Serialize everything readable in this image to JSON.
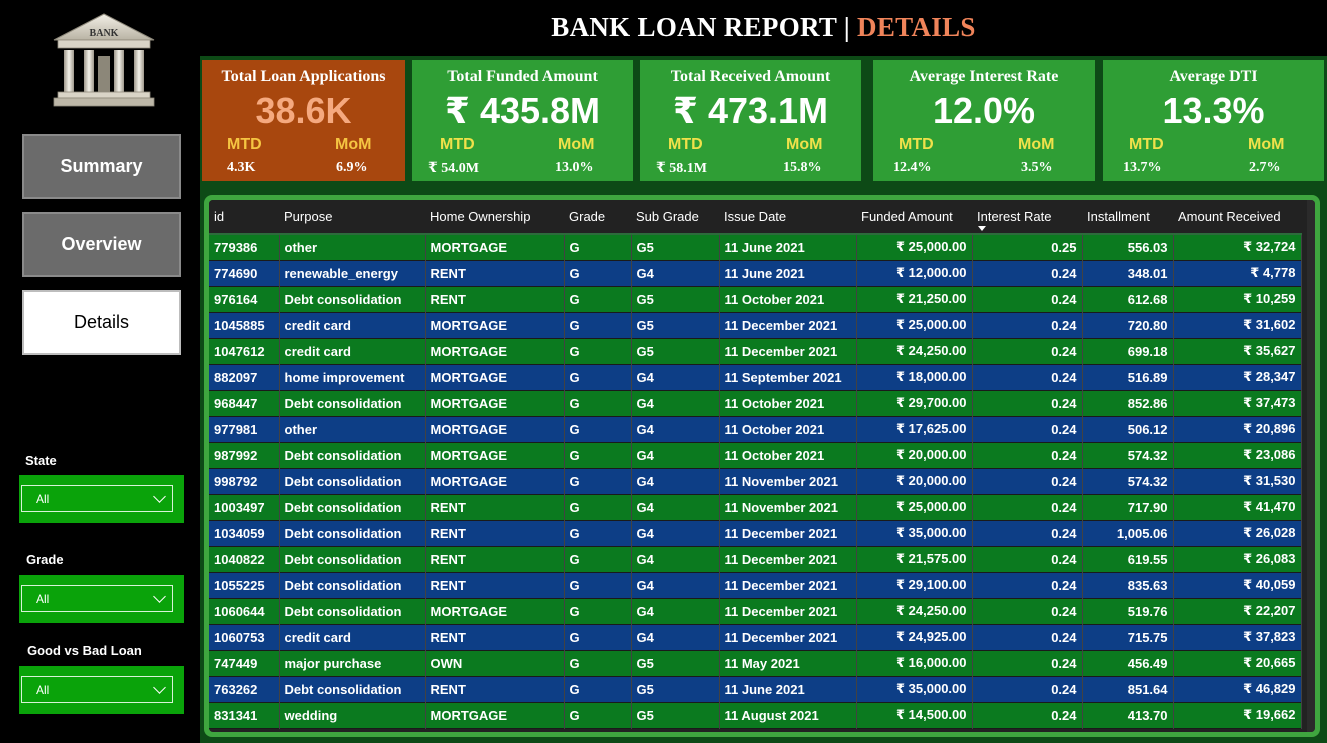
{
  "title": {
    "main": "BANK LOAN REPORT",
    "separator": "|",
    "page": "DETAILS"
  },
  "logo": {
    "text": "BANK"
  },
  "nav": [
    {
      "label": "Summary",
      "active": false
    },
    {
      "label": "Overview",
      "active": false
    },
    {
      "label": "Details",
      "active": true
    }
  ],
  "filters": [
    {
      "label": "State",
      "value": "All"
    },
    {
      "label": "Grade",
      "value": "All"
    },
    {
      "label": "Good vs Bad Loan",
      "value": "All"
    }
  ],
  "kpis": [
    {
      "title": "Total Loan Applications",
      "value": "38.6K",
      "mtd_label": "MTD",
      "mom_label": "MoM",
      "mtd": "4.3K",
      "mom": "6.9%"
    },
    {
      "title": "Total Funded Amount",
      "value": "₹ 435.8M",
      "mtd_label": "MTD",
      "mom_label": "MoM",
      "mtd": "₹ 54.0M",
      "mom": "13.0%"
    },
    {
      "title": "Total Received Amount",
      "value": "₹ 473.1M",
      "mtd_label": "MTD",
      "mom_label": "MoM",
      "mtd": "₹ 58.1M",
      "mom": "15.8%"
    },
    {
      "title": "Average Interest Rate",
      "value": "12.0%",
      "mtd_label": "MTD",
      "mom_label": "MoM",
      "mtd": "12.4%",
      "mom": "3.5%"
    },
    {
      "title": "Average DTI",
      "value": "13.3%",
      "mtd_label": "MTD",
      "mom_label": "MoM",
      "mtd": "13.7%",
      "mom": "2.7%"
    }
  ],
  "colors": {
    "kpi_orange": "#a8470e",
    "kpi_green": "#2f9e35",
    "row_green": "#0b7a1f",
    "row_blue": "#0d3e86",
    "title_accent": "#f0845a"
  },
  "table": {
    "sorted_column": "Interest Rate",
    "sort_direction": "descending",
    "columns": [
      "id",
      "Purpose",
      "Home Ownership",
      "Grade",
      "Sub Grade",
      "Issue Date",
      "Funded Amount",
      "Interest Rate",
      "Installment",
      "Amount Received"
    ],
    "rows": [
      [
        "779386",
        "other",
        "MORTGAGE",
        "G",
        "G5",
        "11 June 2021",
        "₹ 25,000.00",
        "0.25",
        "556.03",
        "₹ 32,724"
      ],
      [
        "774690",
        "renewable_energy",
        "RENT",
        "G",
        "G4",
        "11 June 2021",
        "₹ 12,000.00",
        "0.24",
        "348.01",
        "₹ 4,778"
      ],
      [
        "976164",
        "Debt consolidation",
        "RENT",
        "G",
        "G5",
        "11 October 2021",
        "₹ 21,250.00",
        "0.24",
        "612.68",
        "₹ 10,259"
      ],
      [
        "1045885",
        "credit card",
        "MORTGAGE",
        "G",
        "G5",
        "11 December 2021",
        "₹ 25,000.00",
        "0.24",
        "720.80",
        "₹ 31,602"
      ],
      [
        "1047612",
        "credit card",
        "MORTGAGE",
        "G",
        "G5",
        "11 December 2021",
        "₹ 24,250.00",
        "0.24",
        "699.18",
        "₹ 35,627"
      ],
      [
        "882097",
        "home improvement",
        "MORTGAGE",
        "G",
        "G4",
        "11 September 2021",
        "₹ 18,000.00",
        "0.24",
        "516.89",
        "₹ 28,347"
      ],
      [
        "968447",
        "Debt consolidation",
        "MORTGAGE",
        "G",
        "G4",
        "11 October 2021",
        "₹ 29,700.00",
        "0.24",
        "852.86",
        "₹ 37,473"
      ],
      [
        "977981",
        "other",
        "MORTGAGE",
        "G",
        "G4",
        "11 October 2021",
        "₹ 17,625.00",
        "0.24",
        "506.12",
        "₹ 20,896"
      ],
      [
        "987992",
        "Debt consolidation",
        "MORTGAGE",
        "G",
        "G4",
        "11 October 2021",
        "₹ 20,000.00",
        "0.24",
        "574.32",
        "₹ 23,086"
      ],
      [
        "998792",
        "Debt consolidation",
        "MORTGAGE",
        "G",
        "G4",
        "11 November 2021",
        "₹ 20,000.00",
        "0.24",
        "574.32",
        "₹ 31,530"
      ],
      [
        "1003497",
        "Debt consolidation",
        "RENT",
        "G",
        "G4",
        "11 November 2021",
        "₹ 25,000.00",
        "0.24",
        "717.90",
        "₹ 41,470"
      ],
      [
        "1034059",
        "Debt consolidation",
        "RENT",
        "G",
        "G4",
        "11 December 2021",
        "₹ 35,000.00",
        "0.24",
        "1,005.06",
        "₹ 26,028"
      ],
      [
        "1040822",
        "Debt consolidation",
        "RENT",
        "G",
        "G4",
        "11 December 2021",
        "₹ 21,575.00",
        "0.24",
        "619.55",
        "₹ 26,083"
      ],
      [
        "1055225",
        "Debt consolidation",
        "RENT",
        "G",
        "G4",
        "11 December 2021",
        "₹ 29,100.00",
        "0.24",
        "835.63",
        "₹ 40,059"
      ],
      [
        "1060644",
        "Debt consolidation",
        "MORTGAGE",
        "G",
        "G4",
        "11 December 2021",
        "₹ 24,250.00",
        "0.24",
        "519.76",
        "₹ 22,207"
      ],
      [
        "1060753",
        "credit card",
        "RENT",
        "G",
        "G4",
        "11 December 2021",
        "₹ 24,925.00",
        "0.24",
        "715.75",
        "₹ 37,823"
      ],
      [
        "747449",
        "major purchase",
        "OWN",
        "G",
        "G5",
        "11 May 2021",
        "₹ 16,000.00",
        "0.24",
        "456.49",
        "₹ 20,665"
      ],
      [
        "763262",
        "Debt consolidation",
        "RENT",
        "G",
        "G5",
        "11 June 2021",
        "₹ 35,000.00",
        "0.24",
        "851.64",
        "₹ 46,829"
      ],
      [
        "831341",
        "wedding",
        "MORTGAGE",
        "G",
        "G5",
        "11 August 2021",
        "₹ 14,500.00",
        "0.24",
        "413.70",
        "₹ 19,662"
      ]
    ]
  }
}
